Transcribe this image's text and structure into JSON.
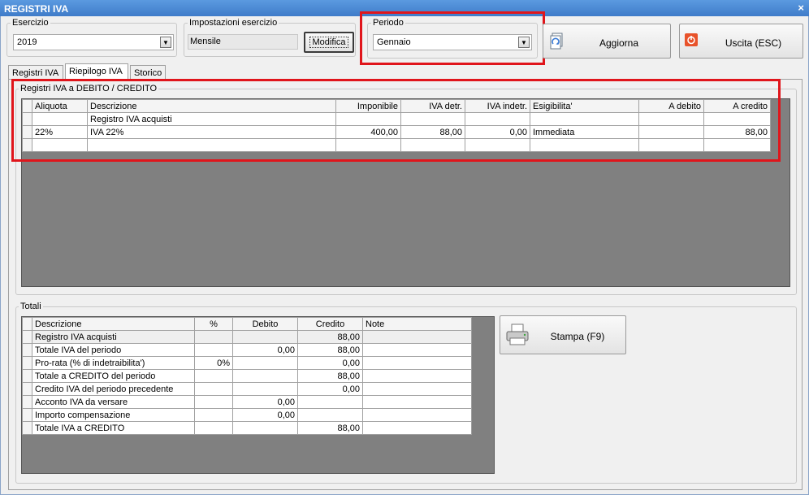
{
  "window": {
    "title": "REGISTRI IVA",
    "close": "×"
  },
  "esercizio": {
    "legend": "Esercizio",
    "value": "2019"
  },
  "impostazioni": {
    "legend": "Impostazioni esercizio",
    "value": "Mensile",
    "modifica_label": "Modifica"
  },
  "periodo": {
    "legend": "Periodo",
    "value": "Gennaio"
  },
  "toolbar": {
    "aggiorna_label": "Aggiorna",
    "uscita_label": "Uscita (ESC)",
    "stampa_label": "Stampa (F9)"
  },
  "tabs": [
    {
      "label": "Registri IVA"
    },
    {
      "label": "Riepilogo IVA"
    },
    {
      "label": "Storico"
    }
  ],
  "registri": {
    "legend": "Registri IVA a DEBITO / CREDITO",
    "columns": [
      "Aliquota",
      "Descrizione",
      "Imponibile",
      "IVA detr.",
      "IVA indetr.",
      "Esigibilita'",
      "A debito",
      "A credito"
    ],
    "group_label": "Registro IVA acquisti",
    "row": {
      "aliquota": "22%",
      "descrizione": "IVA 22%",
      "imponibile": "400,00",
      "iva_detr": "88,00",
      "iva_indetr": "0,00",
      "esigibilita": "Immediata",
      "a_debito": "",
      "a_credito": "88,00"
    }
  },
  "totali": {
    "legend": "Totali",
    "columns": [
      "Descrizione",
      "%",
      "Debito",
      "Credito",
      "Note"
    ],
    "rows": [
      {
        "descrizione": "Registro IVA acquisti",
        "pct": "",
        "debito": "",
        "credito": "88,00",
        "note": "",
        "bold": false
      },
      {
        "descrizione": "Totale IVA del periodo",
        "pct": "",
        "debito": "0,00",
        "credito": "88,00",
        "note": "",
        "bold": true
      },
      {
        "descrizione": "Pro-rata (% di indetraibilita')",
        "pct": "0%",
        "debito": "",
        "credito": "0,00",
        "note": "",
        "bold": false
      },
      {
        "descrizione": "Totale a CREDITO del periodo",
        "pct": "",
        "debito": "",
        "credito": "88,00",
        "note": "",
        "bold": true
      },
      {
        "descrizione": "Credito IVA del periodo precedente",
        "pct": "",
        "debito": "",
        "credito": "0,00",
        "note": "",
        "bold": false
      },
      {
        "descrizione": "Acconto IVA da versare",
        "pct": "",
        "debito": "0,00",
        "credito": "",
        "note": "",
        "bold": false
      },
      {
        "descrizione": "Importo compensazione",
        "pct": "",
        "debito": "0,00",
        "credito": "",
        "note": "",
        "bold": false
      },
      {
        "descrizione": "Totale IVA a CREDITO",
        "pct": "",
        "debito": "",
        "credito": "88,00",
        "note": "",
        "bold": true
      }
    ]
  },
  "colors": {
    "highlight": "#e0151b",
    "grid_bg": "#808080",
    "title_bar": "#3f7cc9",
    "exit_icon": "#e8522a"
  },
  "icons": {
    "aggiorna": "refresh-document-icon",
    "uscita": "power-icon",
    "stampa": "printer-icon",
    "dropdown": "chevron-down-icon",
    "close": "close-icon"
  }
}
